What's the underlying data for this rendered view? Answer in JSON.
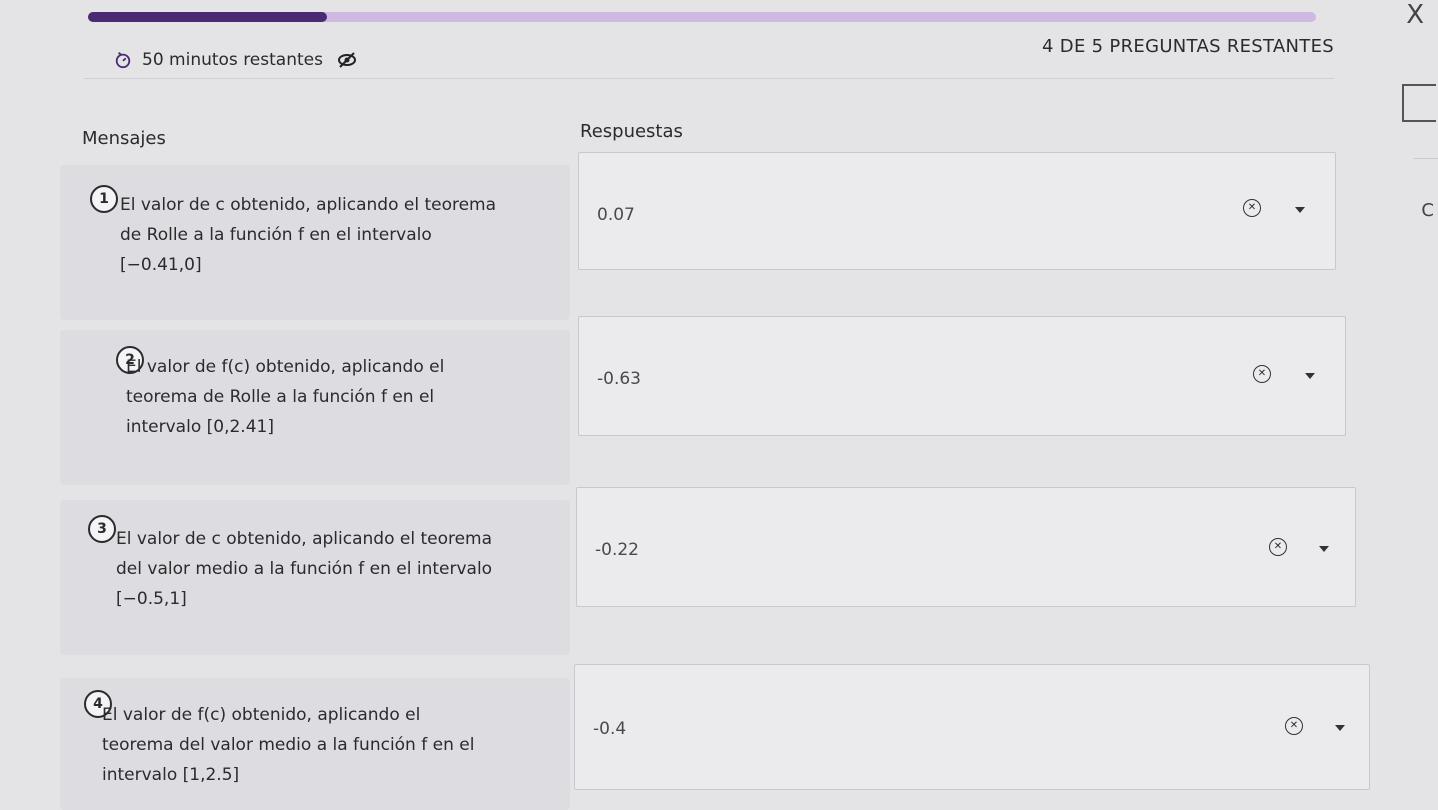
{
  "progress": {
    "fraction": 0.195,
    "fill_color": "#4a2b73",
    "track_color": "#cdb9e2"
  },
  "header": {
    "timer_text": "50 minutos restantes",
    "remaining_text": "4 DE 5 PREGUNTAS RESTANTES"
  },
  "columns": {
    "messages": "Mensajes",
    "answers": "Respuestas"
  },
  "questions": [
    {
      "num": "1",
      "text": "El valor de c obtenido, aplicando el teorema\nde Rolle a la función f en el intervalo\n[−0.41,0]",
      "answer": "0.07"
    },
    {
      "num": "2",
      "text": "El valor de f(c) obtenido, aplicando el\nteorema de Rolle a la función f en el\nintervalo [0,2.41]",
      "answer": "-0.63"
    },
    {
      "num": "3",
      "text": "El valor de c obtenido, aplicando el teorema\ndel valor medio a la función f en el intervalo\n[−0.5,1]",
      "answer": "-0.22"
    },
    {
      "num": "4",
      "text": "El valor de f(c) obtenido, aplicando el\nteorema del valor medio a la función f en el\nintervalo [1,2.5]",
      "answer": "-0.4"
    }
  ],
  "edge": {
    "letter": "C",
    "close_glyph": "X"
  },
  "icons": {
    "timer": "timer-icon",
    "hide": "eye-off-icon",
    "clear": "clear-icon",
    "caret": "caret-down-icon"
  }
}
